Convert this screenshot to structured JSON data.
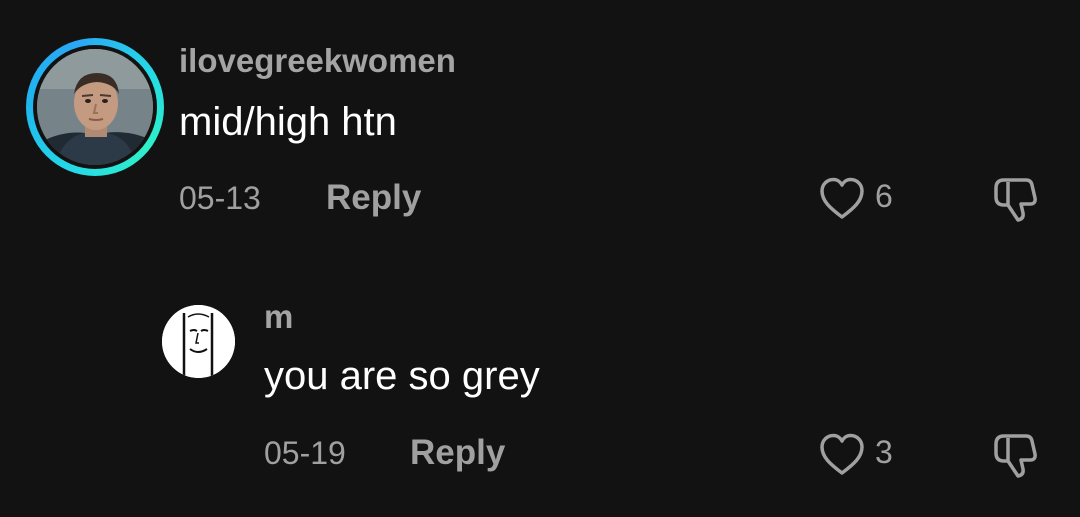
{
  "comments": [
    {
      "username": "ilovegreekwomen",
      "text": "mid/high htn",
      "date": "05-13",
      "reply_label": "Reply",
      "likes": "6",
      "avatar_ring": true
    },
    {
      "username": "m",
      "text": "you are so grey",
      "date": "05-19",
      "reply_label": "Reply",
      "likes": "3",
      "avatar_ring": false
    }
  ],
  "icons": {
    "like": "heart-outline-icon",
    "dislike": "thumbs-down-outline-icon"
  },
  "colors": {
    "background": "#121212",
    "username": "#a4a4a4",
    "text": "#ffffff",
    "meta": "#a0a0a0",
    "ring_primary": "#25d9e6",
    "ring_secondary": "#2aa7f5"
  }
}
